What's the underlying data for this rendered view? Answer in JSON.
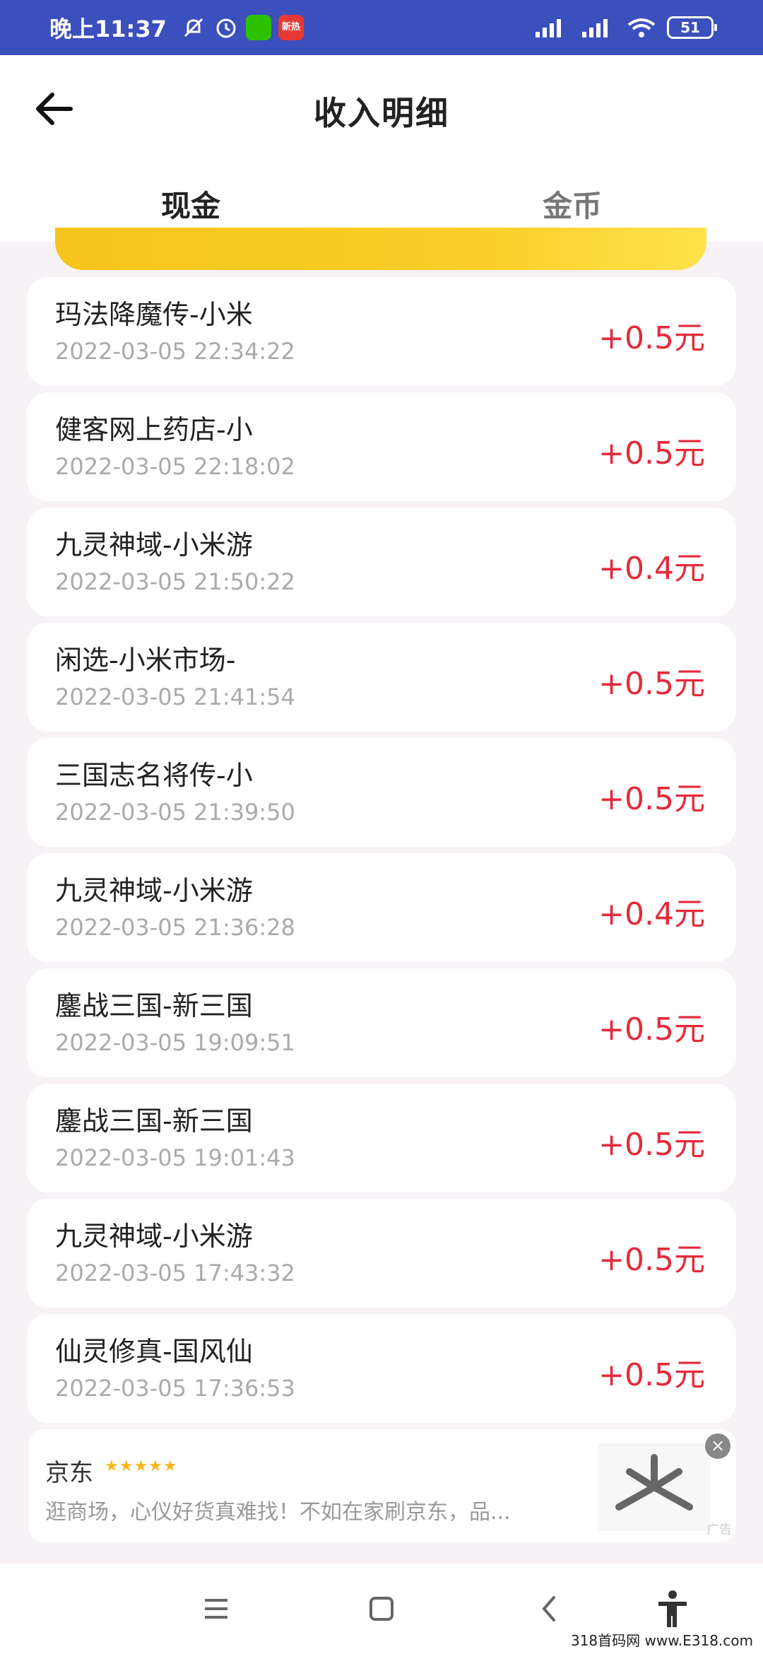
{
  "status_bar": {
    "time": "晚上11:37",
    "news_badge": "新热",
    "battery": "51"
  },
  "header": {
    "title": "收入明细"
  },
  "tabs": [
    {
      "label": "现金"
    },
    {
      "label": "金币"
    }
  ],
  "records": [
    {
      "name": "玛法降魔传-小米",
      "time": "2022-03-05 22:34:22",
      "amount": "+0.5元"
    },
    {
      "name": "健客网上药店-小",
      "time": "2022-03-05 22:18:02",
      "amount": "+0.5元"
    },
    {
      "name": "九灵神域-小米游",
      "time": "2022-03-05 21:50:22",
      "amount": "+0.4元"
    },
    {
      "name": "闲选-小米市场-",
      "time": "2022-03-05 21:41:54",
      "amount": "+0.5元"
    },
    {
      "name": "三国志名将传-小",
      "time": "2022-03-05 21:39:50",
      "amount": "+0.5元"
    },
    {
      "name": "九灵神域-小米游",
      "time": "2022-03-05 21:36:28",
      "amount": "+0.4元"
    },
    {
      "name": "鏖战三国-新三国",
      "time": "2022-03-05 19:09:51",
      "amount": "+0.5元"
    },
    {
      "name": "鏖战三国-新三国",
      "time": "2022-03-05 19:01:43",
      "amount": "+0.5元"
    },
    {
      "name": "九灵神域-小米游",
      "time": "2022-03-05 17:43:32",
      "amount": "+0.5元"
    },
    {
      "name": "仙灵修真-国风仙",
      "time": "2022-03-05 17:36:53",
      "amount": "+0.5元"
    }
  ],
  "ad": {
    "brand": "京东",
    "stars": "★★★★★",
    "description": "逛商场，心仪好货真难找！不如在家刷京东，品...",
    "tag": "广告",
    "close": "×"
  },
  "watermark": "318首码网 www.E318.com",
  "colors": {
    "status_bar": "#3b4fbd",
    "accent_yellow": "#f6c31c",
    "amount_red": "#e52a3a"
  }
}
